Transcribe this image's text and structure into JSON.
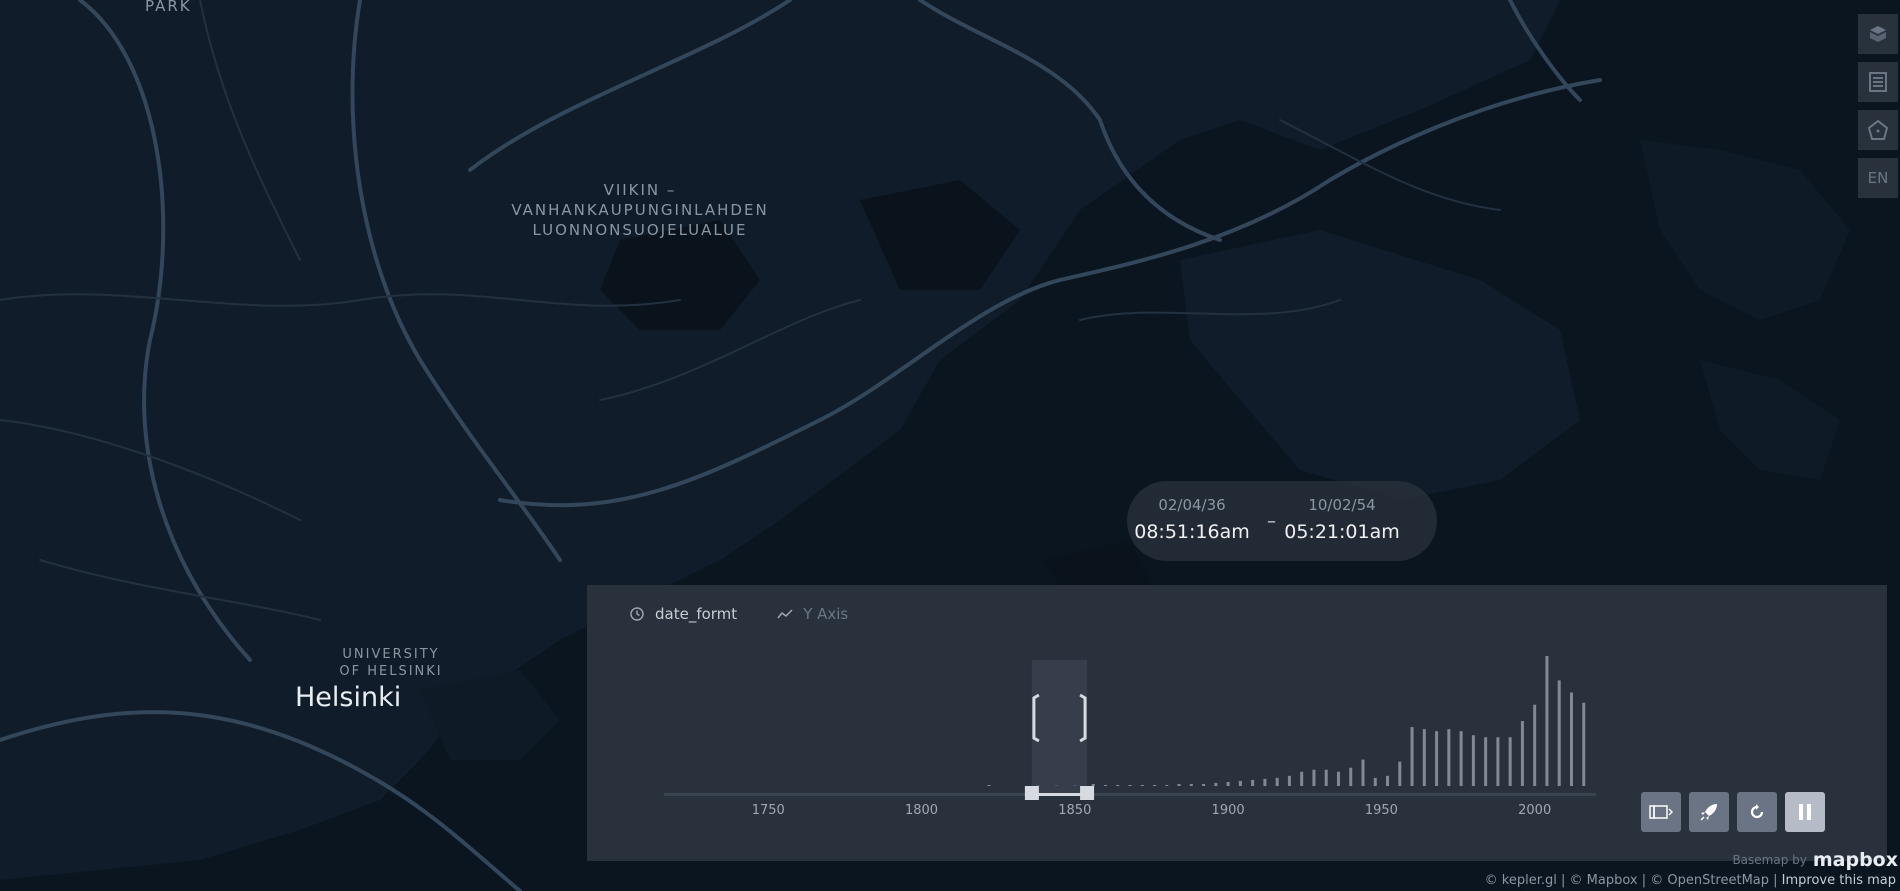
{
  "map": {
    "labels": {
      "park": "PARK",
      "viikki": [
        "VIIKIN –",
        "VANHANKAUPUNGINLAHDEN",
        "LUONNONSUOJELUALUE"
      ],
      "university": [
        "UNIVERSITY",
        "OF HELSINKI"
      ],
      "city": "Helsinki"
    },
    "colors": {
      "background": "#0c1622",
      "land": "#111d2b",
      "water": "#0a121c",
      "roads": "#3a4a5c"
    }
  },
  "side_controls": [
    {
      "icon": "layer-3d-icon",
      "label": ""
    },
    {
      "icon": "legend-icon",
      "label": ""
    },
    {
      "icon": "draw-polygon-icon",
      "label": ""
    },
    {
      "icon": "locale-icon",
      "label": "EN"
    }
  ],
  "time_display": {
    "start_date": "02/04/36",
    "start_time": "08:51:16am",
    "separator": "–",
    "end_date": "10/02/54",
    "end_time": "05:21:01am"
  },
  "timeline": {
    "field_name": "date_formt",
    "y_axis_label": "Y Axis",
    "ticks": [
      "1750",
      "1800",
      "1850",
      "1900",
      "1950",
      "2000"
    ],
    "selected_range": [
      1836,
      1854
    ],
    "animation_buttons": [
      {
        "icon": "animation-window-icon"
      },
      {
        "icon": "speed-rocket-icon"
      },
      {
        "icon": "reset-icon"
      },
      {
        "icon": "pause-icon"
      }
    ]
  },
  "chart_data": {
    "type": "bar",
    "x": [
      1822,
      1838,
      1844,
      1850,
      1856,
      1860,
      1864,
      1868,
      1872,
      1876,
      1880,
      1884,
      1888,
      1892,
      1896,
      1900,
      1904,
      1908,
      1912,
      1916,
      1920,
      1924,
      1928,
      1932,
      1936,
      1940,
      1944,
      1948,
      1952,
      1956,
      1960,
      1964,
      1968,
      1972,
      1976,
      1980,
      1984,
      1988,
      1992,
      1996,
      2000,
      2004,
      2008,
      2012,
      2016
    ],
    "values": [
      1,
      1,
      1,
      1,
      2,
      1,
      1,
      1,
      1,
      1,
      1,
      2,
      2,
      2,
      3,
      4,
      5,
      6,
      7,
      8,
      10,
      14,
      16,
      16,
      14,
      18,
      26,
      8,
      10,
      24,
      58,
      56,
      54,
      56,
      54,
      50,
      48,
      48,
      48,
      64,
      80,
      128,
      104,
      92,
      82
    ],
    "xlim": [
      1716,
      2020
    ],
    "ticks": [
      1750,
      1800,
      1850,
      1900,
      1950,
      2000
    ],
    "xlabel": "",
    "ylabel": "",
    "grid": false
  },
  "attribution": {
    "text": "© kepler.gl | © Mapbox | © OpenStreetMap |",
    "improve": "Improve this map",
    "basemap_by": "Basemap by",
    "logo": "mapbox"
  }
}
